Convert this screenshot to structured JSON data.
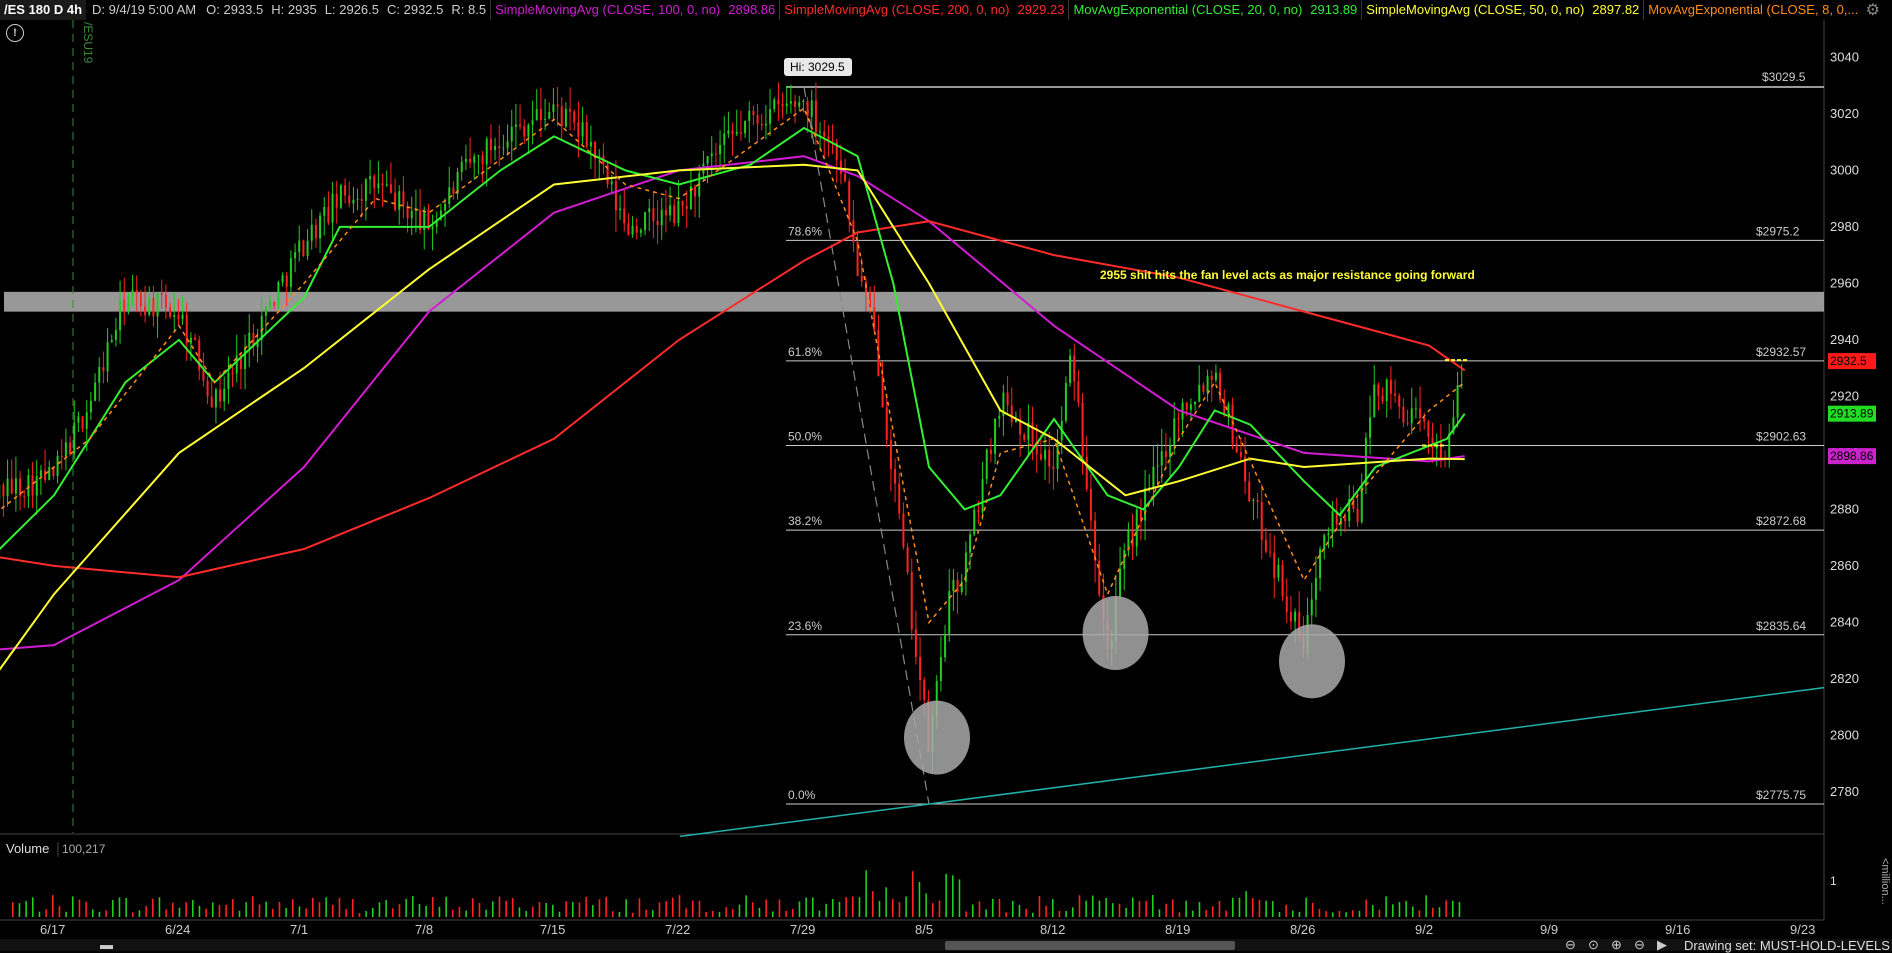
{
  "header": {
    "symbol": "/ES 180 D 4h",
    "date": "D: 9/4/19 5:00 AM",
    "open": "O: 2933.5",
    "high": "H: 2935",
    "low": "L: 2926.5",
    "close": "C: 2932.5",
    "range": "R: 8.5",
    "studies": [
      {
        "label": "SimpleMovingAvg (CLOSE, 100, 0, no)",
        "value": "2898.86",
        "color": "#d21cd2"
      },
      {
        "label": "SimpleMovingAvg (CLOSE, 200, 0, no)",
        "value": "2929.23",
        "color": "#ff2b2b"
      },
      {
        "label": "MovAvgExponential (CLOSE, 20, 0, no)",
        "value": "2913.89",
        "color": "#33ee33"
      },
      {
        "label": "SimpleMovingAvg (CLOSE, 50, 0, no)",
        "value": "2897.82",
        "color": "#ffff33"
      },
      {
        "label": "MovAvgExponential (CLOSE, 8, 0,...",
        "value": "",
        "color": "#ff8c1a"
      }
    ]
  },
  "chart_data": {
    "type": "line",
    "instrument": "/ES",
    "interval": "4h",
    "x_ticks": [
      "6/17",
      "6/24",
      "7/1",
      "7/8",
      "7/15",
      "7/22",
      "7/29",
      "8/5",
      "8/12",
      "8/19",
      "8/26",
      "9/2",
      "9/9",
      "9/16",
      "9/23"
    ],
    "y_ticks": [
      2780,
      2800,
      2820,
      2840,
      2860,
      2880,
      2900,
      2920,
      2940,
      2960,
      2980,
      3000,
      3020,
      3040
    ],
    "ylim": [
      2766,
      3050
    ],
    "price_path": [
      [
        "6/13",
        2885
      ],
      [
        "6/17",
        2892
      ],
      [
        "6/19",
        2918
      ],
      [
        "6/21",
        2955
      ],
      [
        "6/24",
        2950
      ],
      [
        "6/26",
        2918
      ],
      [
        "6/28",
        2940
      ],
      [
        "7/1",
        2975
      ],
      [
        "7/3",
        2990
      ],
      [
        "7/5",
        2995
      ],
      [
        "7/8",
        2980
      ],
      [
        "7/10",
        3000
      ],
      [
        "7/12",
        3012
      ],
      [
        "7/15",
        3022
      ],
      [
        "7/17",
        3010
      ],
      [
        "7/19",
        2980
      ],
      [
        "7/22",
        2985
      ],
      [
        "7/24",
        3005
      ],
      [
        "7/26",
        3018
      ],
      [
        "7/29",
        3025
      ],
      [
        "7/31",
        3005
      ],
      [
        "8/1",
        2965
      ],
      [
        "8/2",
        2940
      ],
      [
        "8/5",
        2795
      ],
      [
        "8/6",
        2845
      ],
      [
        "8/7",
        2860
      ],
      [
        "8/9",
        2920
      ],
      [
        "8/12",
        2895
      ],
      [
        "8/13",
        2935
      ],
      [
        "8/15",
        2830
      ],
      [
        "8/16",
        2865
      ],
      [
        "8/19",
        2915
      ],
      [
        "8/21",
        2930
      ],
      [
        "8/23",
        2885
      ],
      [
        "8/26",
        2830
      ],
      [
        "8/27",
        2875
      ],
      [
        "8/29",
        2880
      ],
      [
        "8/30",
        2925
      ],
      [
        "9/3",
        2900
      ],
      [
        "9/4",
        2932.5
      ]
    ],
    "series": [
      {
        "name": "SimpleMovingAvg (CLOSE, 100, 0, no)",
        "color": "#d21cd2",
        "points": [
          [
            "6/13",
            2830
          ],
          [
            "6/17",
            2832
          ],
          [
            "6/24",
            2855
          ],
          [
            "7/1",
            2895
          ],
          [
            "7/8",
            2950
          ],
          [
            "7/15",
            2985
          ],
          [
            "7/22",
            3000
          ],
          [
            "7/29",
            3005
          ],
          [
            "8/1",
            2998
          ],
          [
            "8/5",
            2982
          ],
          [
            "8/12",
            2945
          ],
          [
            "8/19",
            2915
          ],
          [
            "8/26",
            2900
          ],
          [
            "9/2",
            2897
          ],
          [
            "9/4",
            2898.86
          ]
        ]
      },
      {
        "name": "SimpleMovingAvg (CLOSE, 200, 0, no)",
        "color": "#ff2b2b",
        "points": [
          [
            "6/13",
            2864
          ],
          [
            "6/17",
            2860
          ],
          [
            "6/24",
            2856
          ],
          [
            "7/1",
            2866
          ],
          [
            "7/8",
            2884
          ],
          [
            "7/15",
            2905
          ],
          [
            "7/22",
            2940
          ],
          [
            "7/29",
            2968
          ],
          [
            "8/1",
            2978
          ],
          [
            "8/5",
            2982
          ],
          [
            "8/12",
            2970
          ],
          [
            "8/19",
            2962
          ],
          [
            "8/26",
            2950
          ],
          [
            "9/2",
            2938
          ],
          [
            "9/4",
            2929.23
          ]
        ]
      },
      {
        "name": "MovAvgExponential (CLOSE, 20, 0, no)",
        "color": "#33ee33",
        "points": [
          [
            "6/13",
            2860
          ],
          [
            "6/17",
            2885
          ],
          [
            "6/21",
            2925
          ],
          [
            "6/24",
            2940
          ],
          [
            "6/26",
            2925
          ],
          [
            "7/1",
            2955
          ],
          [
            "7/3",
            2980
          ],
          [
            "7/8",
            2980
          ],
          [
            "7/12",
            3000
          ],
          [
            "7/15",
            3012
          ],
          [
            "7/19",
            3000
          ],
          [
            "7/22",
            2995
          ],
          [
            "7/26",
            3002
          ],
          [
            "7/29",
            3015
          ],
          [
            "8/1",
            3005
          ],
          [
            "8/3",
            2960
          ],
          [
            "8/5",
            2895
          ],
          [
            "8/7",
            2880
          ],
          [
            "8/9",
            2885
          ],
          [
            "8/12",
            2912
          ],
          [
            "8/15",
            2885
          ],
          [
            "8/17",
            2880
          ],
          [
            "8/19",
            2895
          ],
          [
            "8/21",
            2915
          ],
          [
            "8/23",
            2910
          ],
          [
            "8/26",
            2890
          ],
          [
            "8/28",
            2878
          ],
          [
            "8/30",
            2895
          ],
          [
            "9/3",
            2905
          ],
          [
            "9/4",
            2913.89
          ]
        ]
      },
      {
        "name": "SimpleMovingAvg (CLOSE, 50, 0, no)",
        "color": "#ffff33",
        "points": [
          [
            "6/13",
            2815
          ],
          [
            "6/17",
            2850
          ],
          [
            "6/24",
            2900
          ],
          [
            "7/1",
            2930
          ],
          [
            "7/8",
            2965
          ],
          [
            "7/15",
            2995
          ],
          [
            "7/22",
            3000
          ],
          [
            "7/29",
            3002
          ],
          [
            "8/1",
            3000
          ],
          [
            "8/5",
            2960
          ],
          [
            "8/9",
            2915
          ],
          [
            "8/12",
            2905
          ],
          [
            "8/16",
            2885
          ],
          [
            "8/19",
            2890
          ],
          [
            "8/23",
            2898
          ],
          [
            "8/26",
            2895
          ],
          [
            "9/2",
            2898
          ],
          [
            "9/4",
            2897.82
          ]
        ]
      },
      {
        "name": "MovAvgExponential (CLOSE, 8, 0,...",
        "color": "#ff8c1a",
        "points": [
          [
            "6/13",
            2875
          ],
          [
            "6/19",
            2905
          ],
          [
            "6/24",
            2945
          ],
          [
            "6/26",
            2925
          ],
          [
            "7/1",
            2960
          ],
          [
            "7/5",
            2990
          ],
          [
            "7/8",
            2985
          ],
          [
            "7/15",
            3018
          ],
          [
            "7/19",
            2995
          ],
          [
            "7/22",
            2990
          ],
          [
            "7/29",
            3022
          ],
          [
            "8/1",
            2975
          ],
          [
            "8/5",
            2840
          ],
          [
            "8/7",
            2855
          ],
          [
            "8/9",
            2900
          ],
          [
            "8/12",
            2905
          ],
          [
            "8/15",
            2850
          ],
          [
            "8/19",
            2905
          ],
          [
            "8/21",
            2925
          ],
          [
            "8/26",
            2855
          ],
          [
            "8/29",
            2885
          ],
          [
            "9/2",
            2915
          ],
          [
            "9/4",
            2925
          ]
        ]
      }
    ],
    "fib_levels": [
      {
        "pct": "78.6%",
        "price_label": "$2975.2",
        "value": 2975.2
      },
      {
        "pct": "61.8%",
        "price_label": "$2932.57",
        "value": 2932.57
      },
      {
        "pct": "50.0%",
        "price_label": "$2902.63",
        "value": 2902.63
      },
      {
        "pct": "38.2%",
        "price_label": "$2872.68",
        "value": 2872.68
      },
      {
        "pct": "23.6%",
        "price_label": "$2835.64",
        "value": 2835.64
      },
      {
        "pct": "0.0%",
        "price_label": "$2775.75",
        "value": 2775.75
      }
    ],
    "top_level": {
      "price_label": "$3029.5",
      "value": 3029.5
    },
    "hi_label": "Hi: 3029.5",
    "resistance_zone": [
      2950,
      2957
    ],
    "annotation": "2955 shit hits the fan level acts as  major resistance going forward",
    "trendline": [
      [
        "8/5",
        2775.75
      ],
      [
        "9/23",
        2816
      ]
    ],
    "dashed_line": [
      [
        "7/29",
        3029.5
      ],
      [
        "8/5",
        2775.75
      ]
    ],
    "marked_lows": [
      [
        "8/5",
        2795
      ],
      [
        "8/15",
        2832
      ],
      [
        "8/26",
        2822
      ]
    ],
    "price_tags": [
      {
        "text": "2932.5",
        "value": 2932.5,
        "bg": "#ff1a1a",
        "fg": "#000000"
      },
      {
        "text": "2913.89",
        "value": 2913.89,
        "bg": "#22dd22",
        "fg": "#000000"
      },
      {
        "text": "2898.86",
        "value": 2898.86,
        "bg": "#cc22cc",
        "fg": "#000000"
      }
    ],
    "contract_label": "/ESU19",
    "volume": {
      "label": "Volume",
      "value": "100,217",
      "y_tick": "1",
      "unit_label": "<million..."
    }
  },
  "footer": {
    "drawing_set": "Drawing set: MUST-HOLD-LEVELS"
  },
  "colors": {
    "background": "#000000",
    "up": "#22cc22",
    "down": "#ff2222",
    "fib_line": "#cccccc",
    "zone": "#a9a9a9",
    "trendline": "#20b2aa",
    "annotation": "#ffff33"
  }
}
